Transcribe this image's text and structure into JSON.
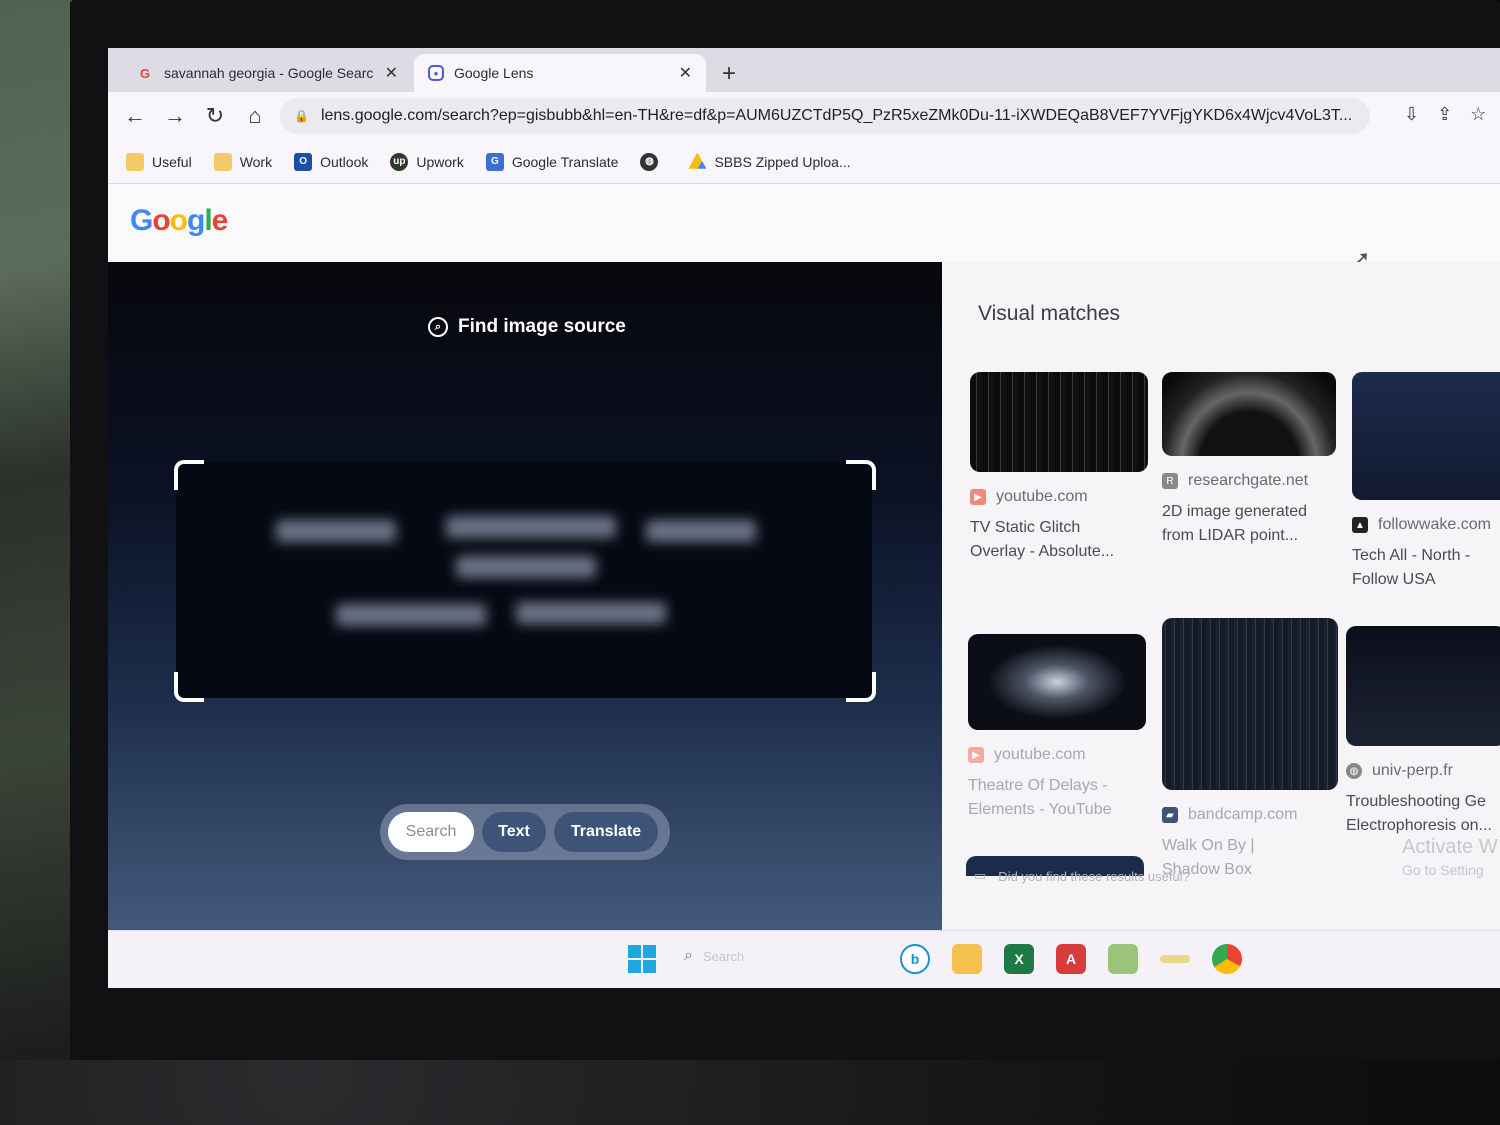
{
  "browser": {
    "tabs": [
      {
        "title": "savannah georgia - Google Searc",
        "favicon": "google-g-icon",
        "active": false
      },
      {
        "title": "Google Lens",
        "favicon": "google-lens-icon",
        "active": true
      }
    ],
    "close_glyph": "✕",
    "new_tab_glyph": "+",
    "nav": {
      "back": "←",
      "forward": "→",
      "reload": "↻",
      "home": "⌂"
    },
    "url": "lens.google.com/search?ep=gisbubb&hl=en-TH&re=df&p=AUM6UZCTdP5Q_PzR5xeZMk0Du-11-iXWDEQaB8VEF7YVFjgYKD6x4Wjcv4VoL3T...",
    "lock_glyph": "🔒",
    "bookmarks": [
      {
        "label": "Useful",
        "icon": "folder-icon"
      },
      {
        "label": "Work",
        "icon": "folder-icon"
      },
      {
        "label": "Outlook",
        "icon": "outlook-icon"
      },
      {
        "label": "Upwork",
        "icon": "upwork-icon"
      },
      {
        "label": "Google Translate",
        "icon": "google-translate-icon"
      },
      {
        "label": "",
        "icon": "globe-icon"
      },
      {
        "label": "SBBS Zipped Uploa...",
        "icon": "google-drive-icon"
      }
    ]
  },
  "google": {
    "logo_letters": [
      "G",
      "o",
      "o",
      "g",
      "l",
      "e"
    ]
  },
  "lens": {
    "find_image_source": "Find image source",
    "modes": {
      "search": "Search",
      "text": "Text",
      "translate": "Translate"
    }
  },
  "visual_matches": {
    "title": "Visual matches",
    "cards": [
      {
        "source": "youtube.com",
        "caption": "TV Static Glitch\nOverlay - Absolute...",
        "icon": "youtube-icon"
      },
      {
        "source": "researchgate.net",
        "caption": "2D image generated\nfrom LIDAR point...",
        "icon": "researchgate-icon"
      },
      {
        "source": "followwake.com",
        "caption": "Tech All - North -\nFollow USA",
        "icon": "followwake-icon"
      },
      {
        "source": "youtube.com",
        "caption": "Theatre Of Delays -\nElements - YouTube",
        "icon": "youtube-icon"
      },
      {
        "source": "bandcamp.com",
        "caption": "Walk On By |\nShadow Box",
        "icon": "bandcamp-icon"
      },
      {
        "source": "univ-perp.fr",
        "caption": "Troubleshooting Ge\nElectrophoresis on...",
        "icon": "globe-icon"
      }
    ],
    "feedback": "Did you find these results useful?",
    "activate_title": "Activate W",
    "activate_sub": "Go to Setting"
  },
  "taskbar": {
    "search_placeholder": "Search",
    "apps": [
      "bing-icon",
      "file-explorer-icon",
      "excel-icon",
      "acrobat-icon",
      "notepad-icon",
      "folder-icon",
      "chrome-icon"
    ]
  },
  "colors": {
    "accent_blue": "#3d5478",
    "google_blue": "#4285f4",
    "google_red": "#ea4335",
    "google_yellow": "#fbbc05",
    "google_green": "#34a853"
  }
}
